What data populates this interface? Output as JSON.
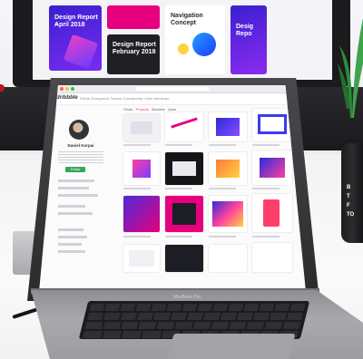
{
  "monitor": {
    "cards": [
      {
        "line1": "Design Report –",
        "line2": "April 2018"
      },
      {
        "line1": "Design Report –",
        "line2": "February 2018"
      },
      {
        "line1": "Navigation",
        "line2": "Concept"
      },
      {
        "line1": "Desig",
        "line2": "Repo"
      }
    ]
  },
  "laptop": {
    "site_logo": "dribbble",
    "nav_links": "Shots  Designers  Teams  Community  Jobs  Meetups",
    "tabs": {
      "first": "Shots",
      "second": "Projects",
      "third": "Buckets",
      "fourth": "Likes"
    },
    "profile": {
      "name": "Daniel Korpai",
      "follow_label": "Follow"
    },
    "model_label": "MacBook Pro"
  },
  "mug": {
    "lines": [
      "B",
      "T",
      "F",
      "TO"
    ]
  },
  "colors": {
    "dribbble_pink": "#ea4c89",
    "follow_green": "#3aa45c",
    "card_purple": "#4c2bd8",
    "card_pink": "#e6007e"
  }
}
